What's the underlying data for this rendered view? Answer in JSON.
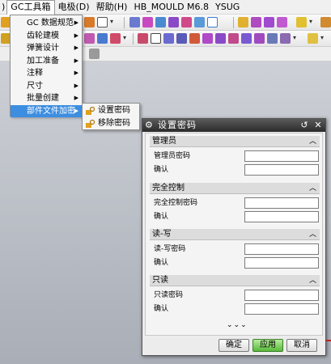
{
  "menubar": {
    "items": [
      "GC工具箱",
      "电极(D)",
      "帮助(H)",
      "HB_MOULD M6.8",
      "YSUG"
    ],
    "active_index": 0
  },
  "dropdown": {
    "items": [
      {
        "label": "GC 数据规范"
      },
      {
        "label": "齿轮建模"
      },
      {
        "label": "弹簧设计"
      },
      {
        "label": "加工准备"
      },
      {
        "label": "注释"
      },
      {
        "label": "尺寸"
      },
      {
        "label": "批量创建"
      },
      {
        "label": "部件文件加密"
      }
    ],
    "highlighted_index": 7
  },
  "submenu": {
    "items": [
      {
        "label": "设置密码",
        "icon": "key-lock-icon"
      },
      {
        "label": "移除密码",
        "icon": "key-lock-icon"
      }
    ]
  },
  "dialog": {
    "title": "设置密码",
    "sections": [
      {
        "header": "管理员",
        "rows": [
          {
            "label": "管理员密码",
            "value": ""
          },
          {
            "label": "确认",
            "value": ""
          }
        ]
      },
      {
        "header": "完全控制",
        "rows": [
          {
            "label": "完全控制密码",
            "value": ""
          },
          {
            "label": "确认",
            "value": ""
          }
        ]
      },
      {
        "header": "读-写",
        "rows": [
          {
            "label": "读-写密码",
            "value": ""
          },
          {
            "label": "确认",
            "value": ""
          }
        ]
      },
      {
        "header": "只读",
        "rows": [
          {
            "label": "只读密码",
            "value": ""
          },
          {
            "label": "确认",
            "value": ""
          }
        ]
      }
    ],
    "more_indicator": "⌄⌄⌄",
    "buttons": {
      "ok": "确定",
      "apply": "应用",
      "cancel": "取消"
    }
  },
  "colors": {
    "accent_highlight": "#3d8ee0",
    "dialog_title_bg": "#333333",
    "apply_button": "#58b83a"
  }
}
